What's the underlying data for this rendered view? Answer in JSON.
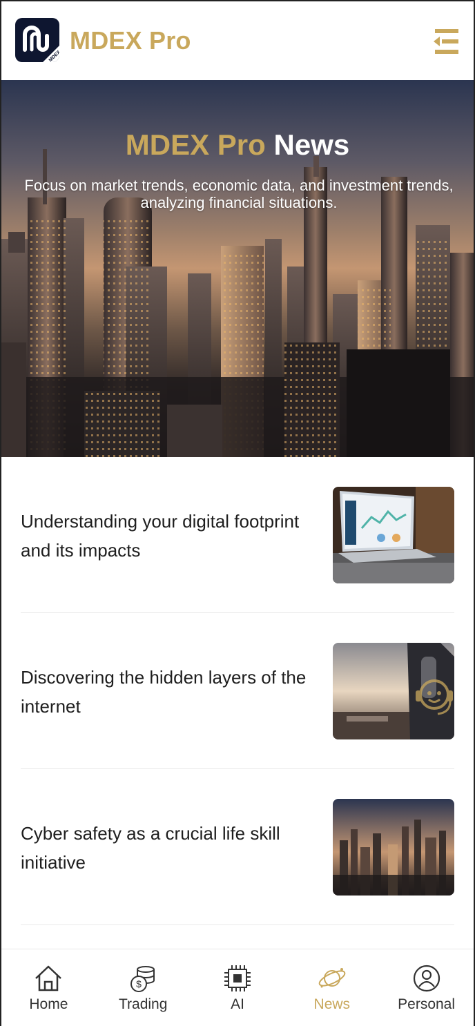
{
  "header": {
    "brand": "MDEX Pro",
    "logo_text": "MDEX",
    "menu_icon": "menu-collapse-icon"
  },
  "hero": {
    "title_gold": "MDEX Pro",
    "title_white": "News",
    "subtitle": "Focus on market trends, economic data, and investment trends, analyzing financial situations."
  },
  "news": [
    {
      "title": "Understanding your digital footprint and its impacts",
      "thumb": "laptop-analytics-image"
    },
    {
      "title": "Discovering the hidden layers of the internet",
      "thumb": "skyscraper-sunset-image"
    },
    {
      "title": "Cyber safety as a crucial life skill initiative",
      "thumb": "city-skyline-image"
    }
  ],
  "tabs": [
    {
      "label": "Home",
      "icon": "home-icon",
      "active": false
    },
    {
      "label": "Trading",
      "icon": "coins-icon",
      "active": false
    },
    {
      "label": "AI",
      "icon": "chip-icon",
      "active": false
    },
    {
      "label": "News",
      "icon": "planet-icon",
      "active": true
    },
    {
      "label": "Personal",
      "icon": "user-icon",
      "active": false
    }
  ],
  "colors": {
    "accent_gold": "#c9a85c",
    "logo_bg": "#0e1630"
  }
}
